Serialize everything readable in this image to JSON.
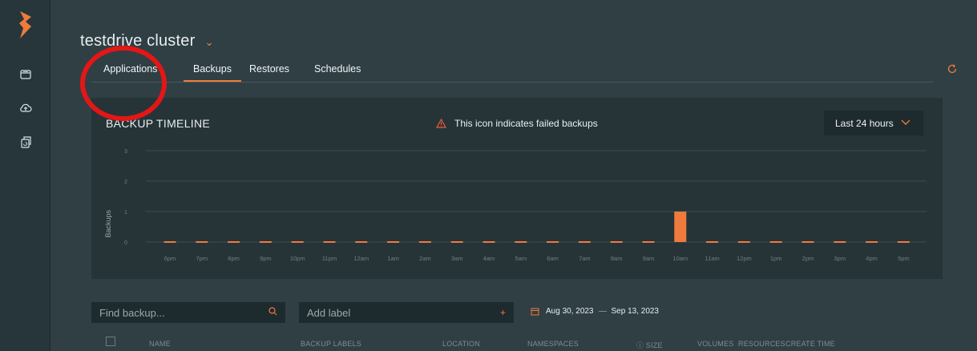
{
  "app": {
    "accent": "#f07a3c",
    "background": "#2f3f44"
  },
  "sidebar": {
    "items": [
      {
        "icon": "window-icon"
      },
      {
        "icon": "cloud-upload-icon"
      },
      {
        "icon": "restore-icon"
      }
    ]
  },
  "header": {
    "cluster_title": "testdrive cluster"
  },
  "tabs": [
    {
      "label": "Applications",
      "active": false
    },
    {
      "label": "Backups",
      "active": true
    },
    {
      "label": "Restores",
      "active": false
    },
    {
      "label": "Schedules",
      "active": false
    }
  ],
  "timeline": {
    "title": "BACKUP TIMELINE",
    "warning_text": "This icon indicates failed backups",
    "range_label": "Last 24 hours"
  },
  "chart_data": {
    "type": "bar",
    "ylabel": "Backups",
    "ylim": [
      0,
      3
    ],
    "yticks": [
      0,
      1,
      2,
      3
    ],
    "categories": [
      "6pm",
      "7pm",
      "8pm",
      "9pm",
      "10pm",
      "11pm",
      "12am",
      "1am",
      "2am",
      "3am",
      "4am",
      "5am",
      "6am",
      "7am",
      "8am",
      "9am",
      "10am",
      "11am",
      "12pm",
      "1pm",
      "2pm",
      "3pm",
      "4pm",
      "5pm"
    ],
    "values": [
      0,
      0,
      0,
      0,
      0,
      0,
      0,
      0,
      0,
      0,
      0,
      0,
      0,
      0,
      0,
      0,
      1,
      0,
      0,
      0,
      0,
      0,
      0,
      0
    ],
    "bar_color": "#f07a3c",
    "grid": true
  },
  "filters": {
    "search_placeholder": "Find backup...",
    "label_placeholder": "Add label",
    "date_from": "Aug 30, 2023",
    "date_to": "Sep 13, 2023"
  },
  "table": {
    "columns": [
      "NAME",
      "BACKUP LABELS",
      "LOCATION",
      "NAMESPACES",
      "SIZE",
      "VOLUMES",
      "RESOURCES",
      "CREATE TIME"
    ]
  }
}
